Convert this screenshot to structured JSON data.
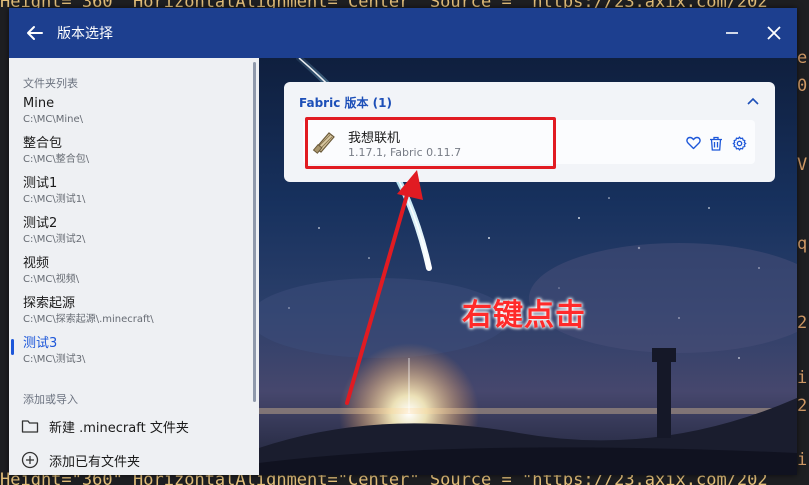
{
  "code_background": {
    "top_line": "Height=\"360\" HorizontalAlignment=\"Center\" Source = \"https://23.axix.com/202",
    "right_chars": [
      "e",
      "0",
      "V",
      "q",
      "2",
      "i",
      "2",
      "i"
    ]
  },
  "window": {
    "title": "版本选择",
    "back_icon": "arrow-left-icon",
    "minimize_icon": "minimize-icon",
    "close_icon": "close-icon"
  },
  "sidebar": {
    "folders_header": "文件夹列表",
    "folders": [
      {
        "name": "Mine",
        "path": "C:\\MC\\Mine\\"
      },
      {
        "name": "整合包",
        "path": "C:\\MC\\整合包\\"
      },
      {
        "name": "测试1",
        "path": "C:\\MC\\测试1\\"
      },
      {
        "name": "测试2",
        "path": "C:\\MC\\测试2\\"
      },
      {
        "name": "视频",
        "path": "C:\\MC\\视频\\"
      },
      {
        "name": "探索起源",
        "path": "C:\\MC\\探索起源\\.minecraft\\"
      },
      {
        "name": "测试3",
        "path": "C:\\MC\\测试3\\"
      }
    ],
    "selected_index": 6,
    "add_header": "添加或导入",
    "actions": [
      {
        "label": "新建 .minecraft 文件夹",
        "icon": "folder-icon"
      },
      {
        "label": "添加已有文件夹",
        "icon": "add-circle-icon"
      }
    ]
  },
  "card": {
    "header": "Fabric 版本 (1)",
    "collapse_icon": "chevron-up-icon",
    "item": {
      "name": "我想联机",
      "details": "1.17.1, Fabric 0.11.7",
      "icon": "fabric-scroll-icon",
      "actions": [
        "heart-icon",
        "trash-icon",
        "gear-icon"
      ]
    }
  },
  "annotation": {
    "text": "右键点击",
    "color": "#ff2a2a"
  },
  "colors": {
    "titlebar": "#1d3f8f",
    "accent": "#1d57d9",
    "highlight": "#e11b22"
  }
}
